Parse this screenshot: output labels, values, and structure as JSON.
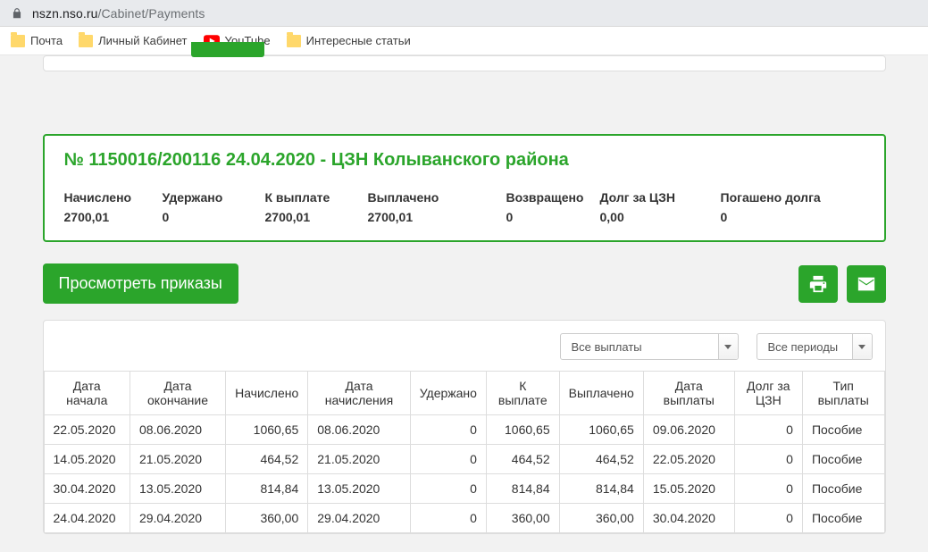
{
  "url_host": "nszn.nso.ru",
  "url_path": "/Cabinet/Payments",
  "bookmarks": [
    "Почта",
    "Личный Кабинет",
    "YouTube",
    "Интересные статьи"
  ],
  "info": {
    "title": "№ 1150016/200116 24.04.2020 - ЦЗН Колыванского района",
    "stats": [
      {
        "lbl": "Начислено",
        "val": "2700,01"
      },
      {
        "lbl": "Удержано",
        "val": "0"
      },
      {
        "lbl": "К выплате",
        "val": "2700,01"
      },
      {
        "lbl": "Выплачено",
        "val": "2700,01"
      },
      {
        "lbl": "Возвращено",
        "val": "0"
      },
      {
        "lbl": "Долг за ЦЗН",
        "val": "0,00"
      },
      {
        "lbl": "Погашено долга",
        "val": "0"
      }
    ]
  },
  "actions": {
    "view_orders": "Просмотреть приказы"
  },
  "filters": {
    "payments": "Все выплаты",
    "periods": "Все периоды"
  },
  "table": {
    "headers": [
      "Дата начала",
      "Дата окончание",
      "Начислено",
      "Дата начисления",
      "Удержано",
      "К выплате",
      "Выплачено",
      "Дата выплаты",
      "Долг за ЦЗН",
      "Тип выплаты"
    ],
    "rows": [
      [
        "22.05.2020",
        "08.06.2020",
        "1060,65",
        "08.06.2020",
        "0",
        "1060,65",
        "1060,65",
        "09.06.2020",
        "0",
        "Пособие"
      ],
      [
        "14.05.2020",
        "21.05.2020",
        "464,52",
        "21.05.2020",
        "0",
        "464,52",
        "464,52",
        "22.05.2020",
        "0",
        "Пособие"
      ],
      [
        "30.04.2020",
        "13.05.2020",
        "814,84",
        "13.05.2020",
        "0",
        "814,84",
        "814,84",
        "15.05.2020",
        "0",
        "Пособие"
      ],
      [
        "24.04.2020",
        "29.04.2020",
        "360,00",
        "29.04.2020",
        "0",
        "360,00",
        "360,00",
        "30.04.2020",
        "0",
        "Пособие"
      ]
    ]
  }
}
